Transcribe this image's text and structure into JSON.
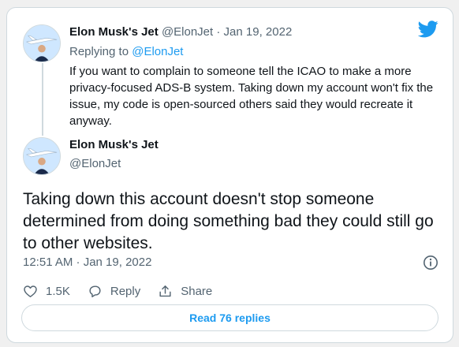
{
  "parent": {
    "name": "Elon Musk's Jet",
    "handle": "@ElonJet",
    "separator": "·",
    "date": "Jan 19, 2022",
    "replying_prefix": "Replying to",
    "replying_handle": "@ElonJet",
    "text": "If you want to complain to someone tell the ICAO to make a more privacy-focused ADS-B system. Taking down my account won't fix the issue, my code is open-sourced others said they would recreate it anyway."
  },
  "tweet": {
    "name": "Elon Musk's Jet",
    "handle": "@ElonJet",
    "text": "Taking down this account doesn't stop someone determined from doing something bad they could still go to other websites.",
    "timestamp": "12:51 AM · Jan 19, 2022"
  },
  "actions": {
    "like_count": "1.5K",
    "reply_label": "Reply",
    "share_label": "Share"
  },
  "read_replies_label": "Read 76 replies",
  "icons": {
    "brand": "twitter-bird-icon",
    "like": "heart-icon",
    "reply": "speech-bubble-icon",
    "share": "share-upload-icon",
    "info": "info-icon"
  },
  "colors": {
    "accent": "#1d9bf0",
    "text": "#0f1419",
    "muted": "#536471",
    "border": "#cfd9de"
  }
}
